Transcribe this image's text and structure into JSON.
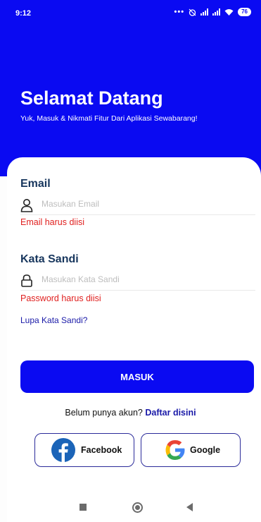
{
  "status_bar": {
    "time": "9:12",
    "battery": "76"
  },
  "hero": {
    "title": "Selamat Datang",
    "subtitle": "Yuk, Masuk & Nikmati Fitur Dari Aplikasi Sewabarang!"
  },
  "form": {
    "email": {
      "label": "Email",
      "placeholder": "Masukan Email",
      "value": "",
      "error": "Email harus diisi",
      "icon": "user-icon"
    },
    "password": {
      "label": "Kata Sandi",
      "placeholder": "Masukan Kata Sandi",
      "value": "",
      "error": "Password harus diisi",
      "icon": "lock-icon"
    },
    "forgot_password": "Lupa Kata Sandi?",
    "submit_label": "MASUK"
  },
  "register": {
    "prompt": "Belum punya akun?",
    "link": "Daftar disini"
  },
  "social": {
    "facebook": {
      "label": "Facebook",
      "icon": "facebook-icon"
    },
    "google": {
      "label": "Google",
      "icon": "google-icon"
    }
  },
  "nav": {
    "icons": [
      "recent-apps-icon",
      "home-icon",
      "back-icon"
    ]
  },
  "colors": {
    "primary": "#0a0af2",
    "error": "#e0201f",
    "heading": "#17365d",
    "link": "#1a1aa8"
  }
}
